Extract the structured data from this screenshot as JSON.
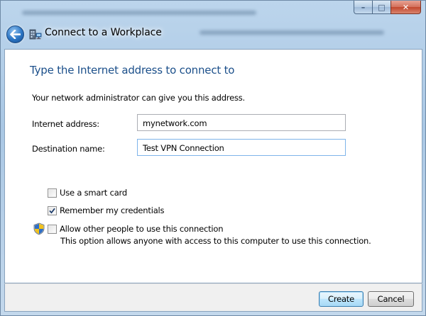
{
  "window": {
    "title": "Connect to a Workplace",
    "caption": {
      "minimize": "–",
      "maximize": "□",
      "close": "✕"
    }
  },
  "page": {
    "heading": "Type the Internet address to connect to",
    "intro": "Your network administrator can give you this address."
  },
  "form": {
    "internet_address": {
      "label": "Internet address:",
      "value": "mynetwork.com"
    },
    "destination_name": {
      "label": "Destination name:",
      "value": "Test VPN Connection"
    }
  },
  "options": {
    "smart_card": {
      "label": "Use a smart card",
      "checked": false
    },
    "remember_credentials": {
      "label": "Remember my credentials",
      "checked": true
    },
    "allow_others": {
      "label": "Allow other people to use this connection",
      "checked": false,
      "hint": "This option allows anyone with access to this computer to use this connection."
    }
  },
  "buttons": {
    "create": "Create",
    "cancel": "Cancel"
  },
  "icons": {
    "back": "back-arrow-icon",
    "window": "network-workplace-icon",
    "shield": "uac-shield-icon"
  },
  "colors": {
    "heading": "#1b4f8a",
    "close_button": "#c2472d",
    "back_button": "#2b75c4"
  }
}
